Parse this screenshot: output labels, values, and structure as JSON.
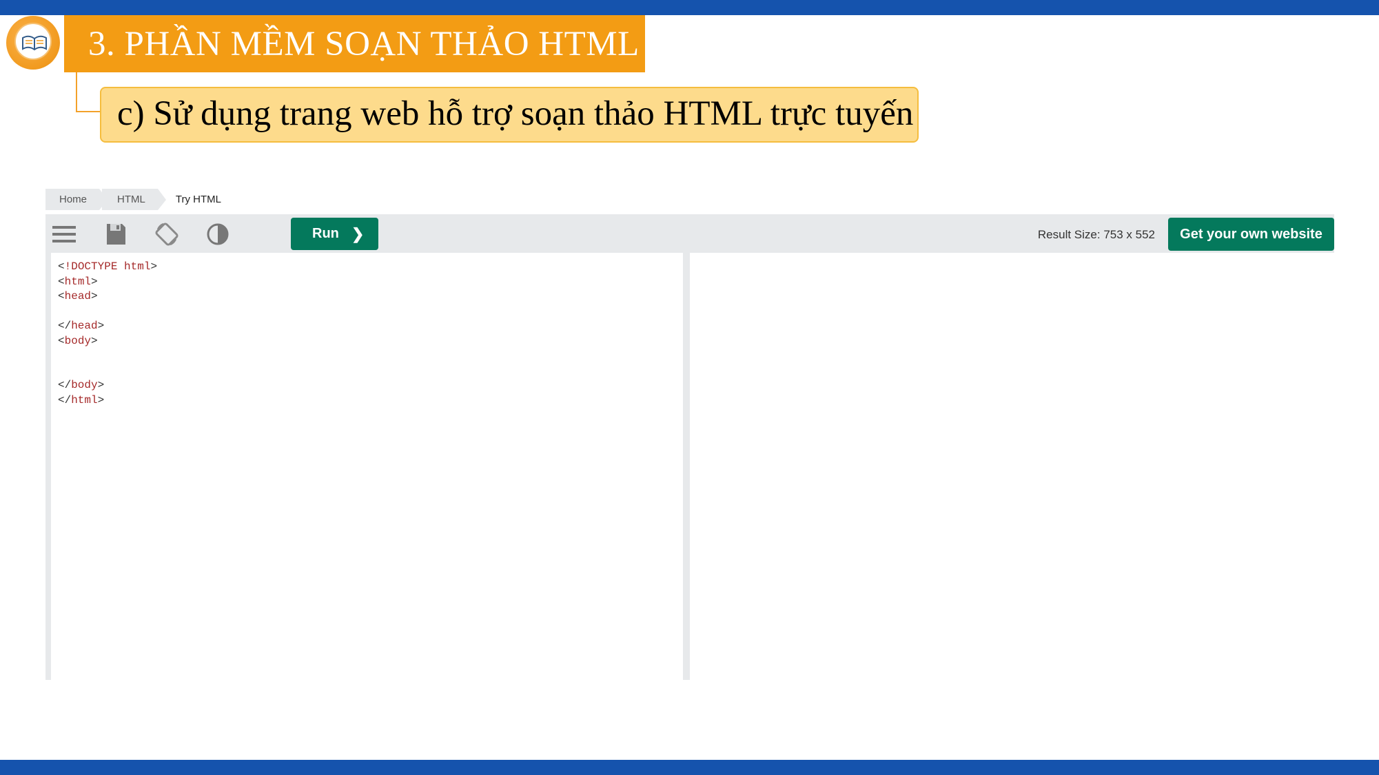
{
  "slide": {
    "title": "3. PHẦN MỀM SOẠN THẢO HTML",
    "subtitle": "c) Sử dụng trang web hỗ trợ soạn thảo HTML trực tuyến",
    "colors": {
      "bars": "#1553ad",
      "title_bg": "#f39c14",
      "subtitle_bg": "#fddb8c"
    },
    "logo_icon": "book-icon"
  },
  "breadcrumb": {
    "items": [
      "Home",
      "HTML",
      "Try HTML"
    ]
  },
  "toolbar": {
    "icons": [
      "menu-icon",
      "save-icon",
      "rotate-icon",
      "contrast-icon"
    ],
    "run_label": "Run",
    "run_chevron": "❯",
    "result_size": "Result Size: 753 x 552",
    "own_site_label": "Get your own website",
    "accent": "#04795c"
  },
  "editor": {
    "lines": [
      {
        "open": "<",
        "tag": "!DOCTYPE html",
        "close": ">"
      },
      {
        "open": "<",
        "tag": "html",
        "close": ">"
      },
      {
        "open": "<",
        "tag": "head",
        "close": ">"
      },
      {
        "open": "",
        "tag": "",
        "close": ""
      },
      {
        "open": "</",
        "tag": "head",
        "close": ">"
      },
      {
        "open": "<",
        "tag": "body",
        "close": ">"
      },
      {
        "open": "",
        "tag": "",
        "close": ""
      },
      {
        "open": "",
        "tag": "",
        "close": ""
      },
      {
        "open": "</",
        "tag": "body",
        "close": ">"
      },
      {
        "open": "</",
        "tag": "html",
        "close": ">"
      }
    ]
  }
}
